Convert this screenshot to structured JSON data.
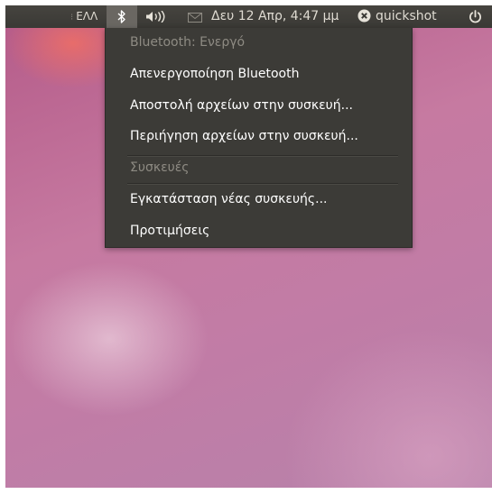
{
  "top_panel": {
    "keyboard_layout": "ΕΛΛ",
    "clock": "Δευ 12 Απρ,  4:47 μμ",
    "user_name": "quickshot",
    "icons": {
      "bluetooth": "bluetooth-icon",
      "volume": "speaker-volume-icon",
      "messaging": "envelope-icon",
      "user_status": "offline-status-icon",
      "session": "power-icon"
    }
  },
  "bluetooth_menu": {
    "status": "Bluetooth: Ενεργό",
    "turn_off": "Απενεργοποίηση Bluetooth",
    "send_files": "Αποστολή αρχείων στην συσκευή...",
    "browse_files": "Περιήγηση αρχείων στην συσκευή...",
    "devices_header": "Συσκευές",
    "setup_new_device": "Εγκατάσταση νέας συσκευής...",
    "preferences": "Προτιμήσεις"
  },
  "colors": {
    "panel": "#3a3935",
    "menu": "#3c3b37",
    "menu_text": "#ffffff",
    "menu_disabled_text": "#8e8b83",
    "wallpaper_accent": "#c17ca6"
  }
}
